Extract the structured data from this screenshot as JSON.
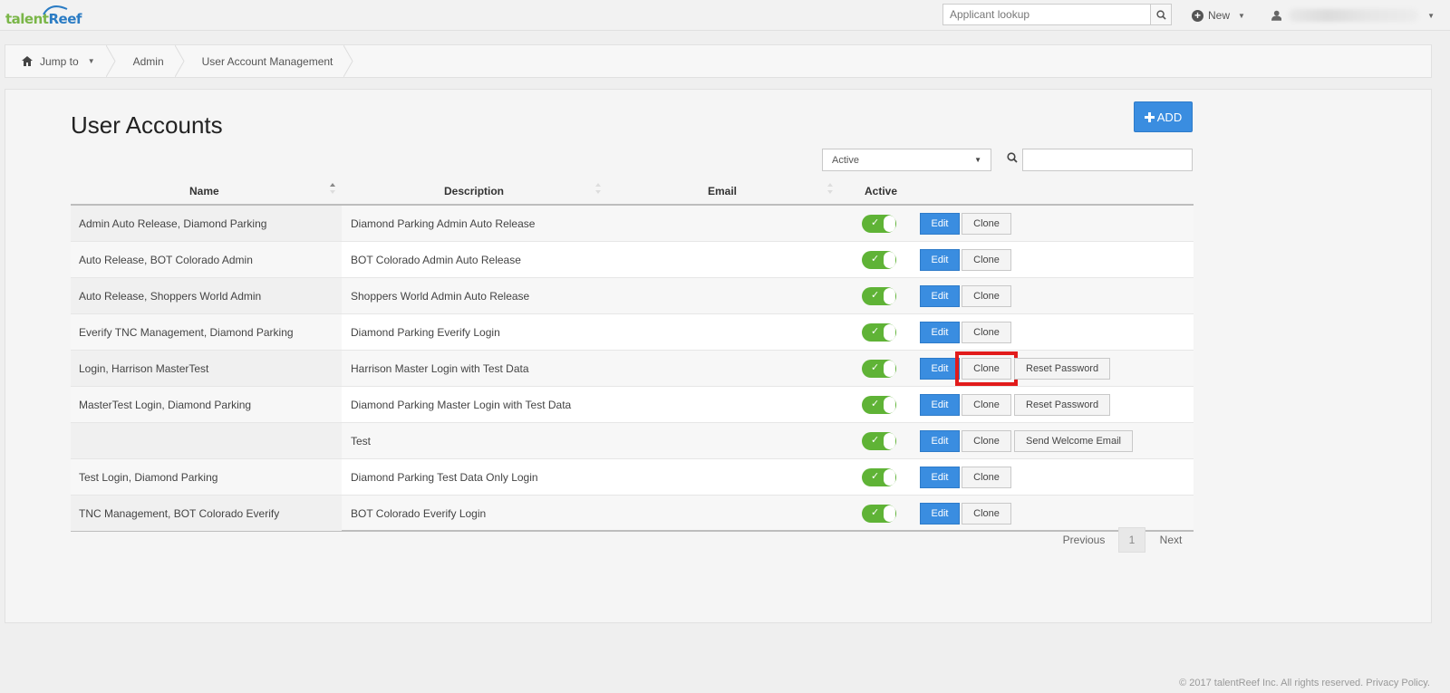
{
  "app": {
    "logo_part1": "talent",
    "logo_part2": "Reef"
  },
  "topbar": {
    "lookup_placeholder": "Applicant lookup",
    "new_label": "New"
  },
  "breadcrumb": {
    "items": [
      "Jump to",
      "Admin",
      "User Account Management"
    ]
  },
  "page": {
    "title": "User Accounts",
    "add_label": "ADD",
    "filter_value": "Active"
  },
  "table": {
    "headers": [
      "Name",
      "Description",
      "Email",
      "Active"
    ],
    "rows": [
      {
        "name": "Admin Auto Release, Diamond Parking",
        "description": "Diamond Parking Admin Auto Release",
        "edit": "Edit",
        "clone": "Clone",
        "extra": ""
      },
      {
        "name": "Auto Release, BOT Colorado Admin",
        "description": "BOT Colorado Admin Auto Release",
        "edit": "Edit",
        "clone": "Clone",
        "extra": ""
      },
      {
        "name": "Auto Release, Shoppers World Admin",
        "description": "Shoppers World Admin Auto Release",
        "edit": "Edit",
        "clone": "Clone",
        "extra": ""
      },
      {
        "name": "Everify TNC Management, Diamond Parking",
        "description": "Diamond Parking Everify Login",
        "edit": "Edit",
        "clone": "Clone",
        "extra": ""
      },
      {
        "name": "Login, Harrison MasterTest",
        "description": "Harrison Master Login with Test Data",
        "edit": "Edit",
        "clone": "Clone",
        "extra": "Reset Password"
      },
      {
        "name": "MasterTest Login, Diamond Parking",
        "description": "Diamond Parking Master Login with Test Data",
        "edit": "Edit",
        "clone": "Clone",
        "extra": "Reset Password"
      },
      {
        "name": "",
        "description": "Test",
        "edit": "Edit",
        "clone": "Clone",
        "extra": "Send Welcome Email"
      },
      {
        "name": "Test Login, Diamond Parking",
        "description": "Diamond Parking Test Data Only Login",
        "edit": "Edit",
        "clone": "Clone",
        "extra": ""
      },
      {
        "name": "TNC Management, BOT Colorado Everify",
        "description": "BOT Colorado Everify Login",
        "edit": "Edit",
        "clone": "Clone",
        "extra": ""
      }
    ]
  },
  "pager": {
    "previous": "Previous",
    "current": "1",
    "next": "Next"
  },
  "footer": {
    "text": "© 2017 talentReef Inc. All rights reserved. Privacy Policy."
  },
  "colors": {
    "primary_blue": "#3a8de0",
    "toggle_green": "#5fb336",
    "highlight_red": "#e21b1b"
  }
}
